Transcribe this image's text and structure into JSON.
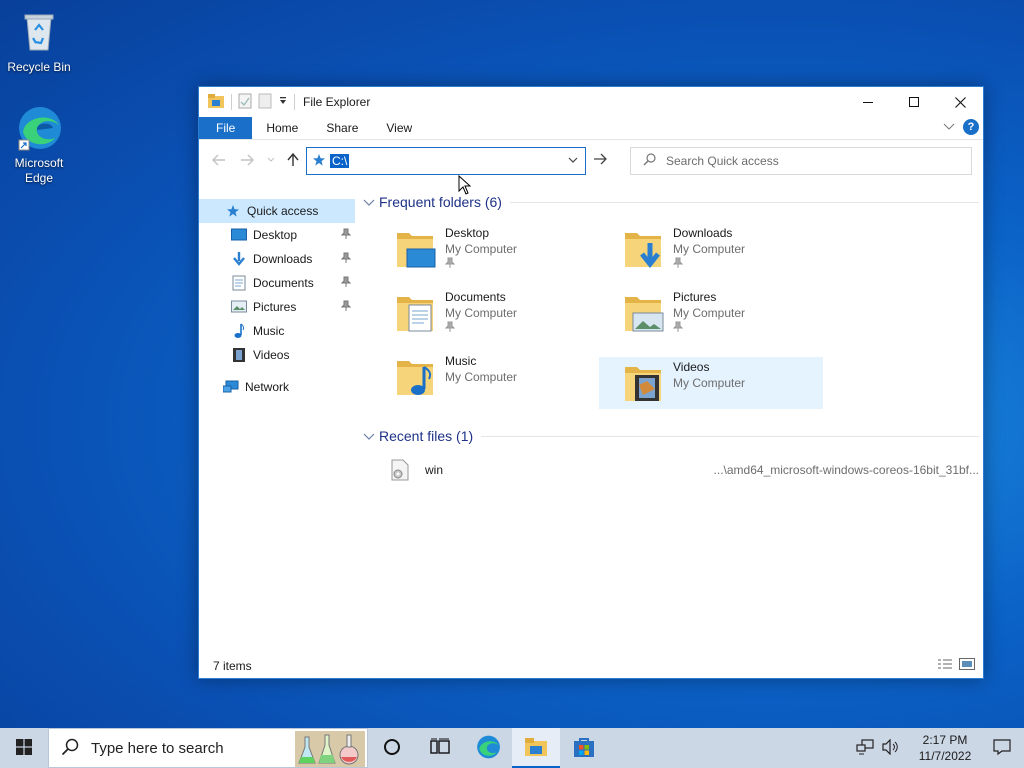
{
  "desktop": {
    "icons": [
      {
        "label": "Recycle Bin"
      },
      {
        "label": "Microsoft Edge"
      }
    ]
  },
  "window": {
    "title": "File Explorer",
    "ribbon_tabs": [
      "File",
      "Home",
      "Share",
      "View"
    ],
    "help_label": "?",
    "address_value": "C:\\",
    "search_placeholder": "Search Quick access",
    "sidebar": {
      "quick_access": "Quick access",
      "items": [
        "Desktop",
        "Downloads",
        "Documents",
        "Pictures",
        "Music",
        "Videos"
      ],
      "network": "Network"
    },
    "frequent_header": "Frequent folders (6)",
    "folders": [
      {
        "name": "Desktop",
        "location": "My Computer",
        "pinned": true
      },
      {
        "name": "Downloads",
        "location": "My Computer",
        "pinned": true
      },
      {
        "name": "Documents",
        "location": "My Computer",
        "pinned": true
      },
      {
        "name": "Pictures",
        "location": "My Computer",
        "pinned": true
      },
      {
        "name": "Music",
        "location": "My Computer",
        "pinned": false
      },
      {
        "name": "Videos",
        "location": "My Computer",
        "pinned": false,
        "selected": true
      }
    ],
    "recent_header": "Recent files (1)",
    "recent_files": [
      {
        "name": "win",
        "path": "...\\amd64_microsoft-windows-coreos-16bit_31bf..."
      }
    ],
    "status": "7 items"
  },
  "taskbar": {
    "search_placeholder": "Type here to search",
    "time": "2:17 PM",
    "date": "11/7/2022"
  },
  "colors": {
    "accent": "#1a6fc9",
    "selection": "#cce8ff",
    "folder": "#f2c55c"
  }
}
